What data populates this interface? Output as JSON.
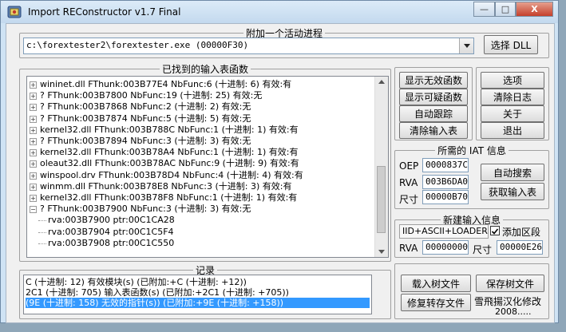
{
  "window": {
    "title": "Import REConstructor v1.7 Final",
    "controls": {
      "minimize": "—",
      "maximize": "□",
      "close": "X"
    }
  },
  "attach": {
    "legend": "附加一个活动进程",
    "process": "c:\\forextester2\\forextester.exe (00000F30)",
    "select_dll": "选择 DLL"
  },
  "imports": {
    "legend": "已找到的输入表函数",
    "rows": [
      "wininet.dll FThunk:003B77E4 NbFunc:6 (十进制: 6) 有效:有",
      "? FThunk:003B7800 NbFunc:19 (十进制: 25) 有效:无",
      "? FThunk:003B7868 NbFunc:2 (十进制: 2) 有效:无",
      "? FThunk:003B7874 NbFunc:5 (十进制: 5) 有效:无",
      "kernel32.dll FThunk:003B788C NbFunc:1 (十进制: 1) 有效:有",
      "? FThunk:003B7894 NbFunc:3 (十进制: 3) 有效:无",
      "kernel32.dll FThunk:003B78A4 NbFunc:1 (十进制: 1) 有效:有",
      "oleaut32.dll FThunk:003B78AC NbFunc:9 (十进制: 9) 有效:有",
      "winspool.drv FThunk:003B78D4 NbFunc:4 (十进制: 4) 有效:有",
      "winmm.dll FThunk:003B78E8 NbFunc:3 (十进制: 3) 有效:有",
      "kernel32.dll FThunk:003B78F8 NbFunc:1 (十进制: 1) 有效:有",
      "? FThunk:003B7900 NbFunc:3 (十进制: 3) 有效:无"
    ],
    "children": [
      "rva:003B7900 ptr:00C1CA28",
      "rva:003B7904 ptr:00C1C5F4",
      "rva:003B7908 ptr:00C1C550"
    ]
  },
  "actions": {
    "show_invalid": "显示无效函数",
    "show_suspect": "显示可疑函数",
    "auto_trace": "自动跟踪",
    "clear_imports": "清除输入表",
    "options": "选项",
    "clear_log": "清除日志",
    "about": "关于",
    "exit": "退出"
  },
  "iat": {
    "legend": "所需的 IAT 信息",
    "oep_label": "OEP",
    "oep": "0000837C",
    "rva_label": "RVA",
    "rva": "003B6DA0",
    "size_label": "尺寸",
    "size": "00000B70",
    "auto_search": "自动搜索",
    "get_imports": "获取输入表"
  },
  "new_import": {
    "legend": "新建输入信息",
    "mode": "IID+ASCII+LOADER",
    "add_section_label": "添加区段",
    "add_section_checked": true,
    "rva_label": "RVA",
    "rva": "00000000",
    "size_label": "尺寸",
    "size": "00000E26"
  },
  "log": {
    "legend": "记录",
    "lines": [
      "C (十进制: 12) 有效模块(s) (已附加:+C (十进制: +12))",
      "2C1 (十进制: 705) 输入表函数(s) (已附加:+2C1 (十进制: +705))",
      "(9E (十进制: 158) 无效的指针(s)) (已附加:+9E (十进制: +158))"
    ],
    "selected_index": 2
  },
  "files": {
    "load_tree": "载入树文件",
    "save_tree": "保存树文件",
    "fix_dump": "修复转存文件",
    "credit": "雪飛揚汉化修改",
    "year": "2008....."
  },
  "colors": {
    "selection": "#3399ff",
    "title_bg": "#cfe3f4",
    "client_bg": "#f0f0f0"
  }
}
